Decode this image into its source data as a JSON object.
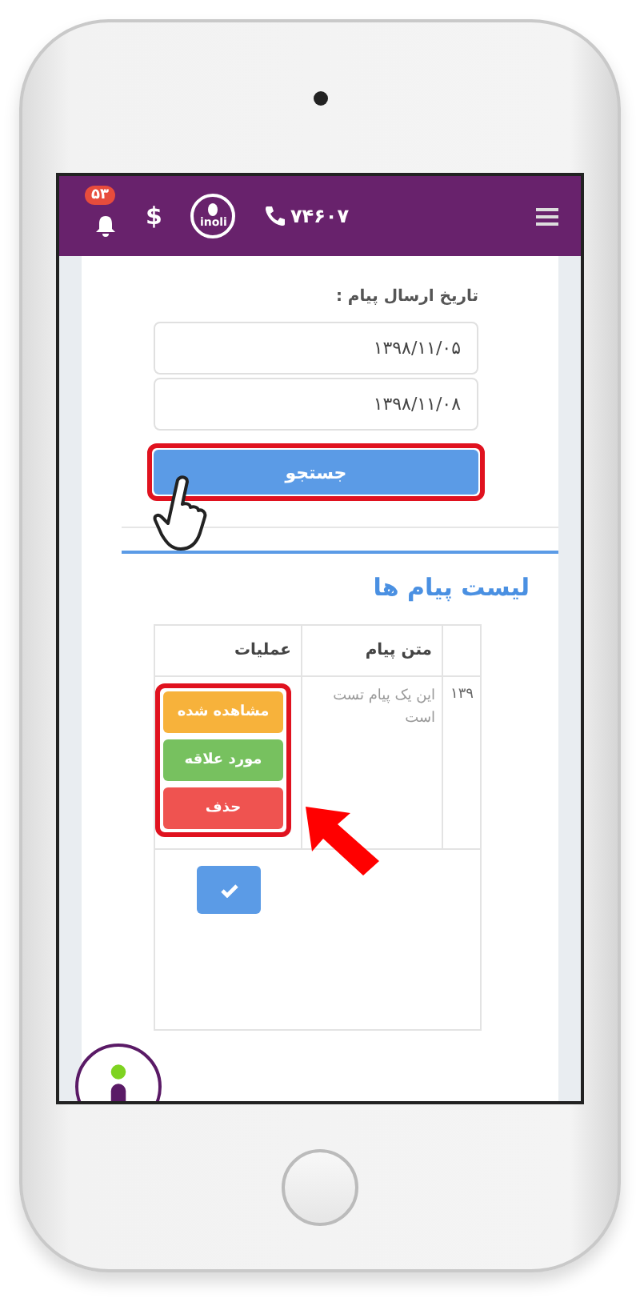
{
  "header": {
    "notification_count": "۵۳",
    "currency_symbol": "$",
    "logo_text": "inoli",
    "phone": "۷۴۶۰۷"
  },
  "filter": {
    "label": "تاریخ ارسال پیام :",
    "date_from": "۱۳۹۸/۱۱/۰۵",
    "date_to": "۱۳۹۸/۱۱/۰۸",
    "search_button": "جستجو"
  },
  "messages": {
    "title": "لیست پیام ها",
    "columns": [
      "متن پیام",
      "عملیات"
    ],
    "rows": [
      {
        "column_1": "۱۳۹",
        "text": "این یک پیام تست است",
        "actions": [
          {
            "label": "مشاهده شده",
            "kind": "seen"
          },
          {
            "label": "مورد علاقه",
            "kind": "favorite"
          },
          {
            "label": "حذف",
            "kind": "delete"
          }
        ]
      }
    ]
  }
}
